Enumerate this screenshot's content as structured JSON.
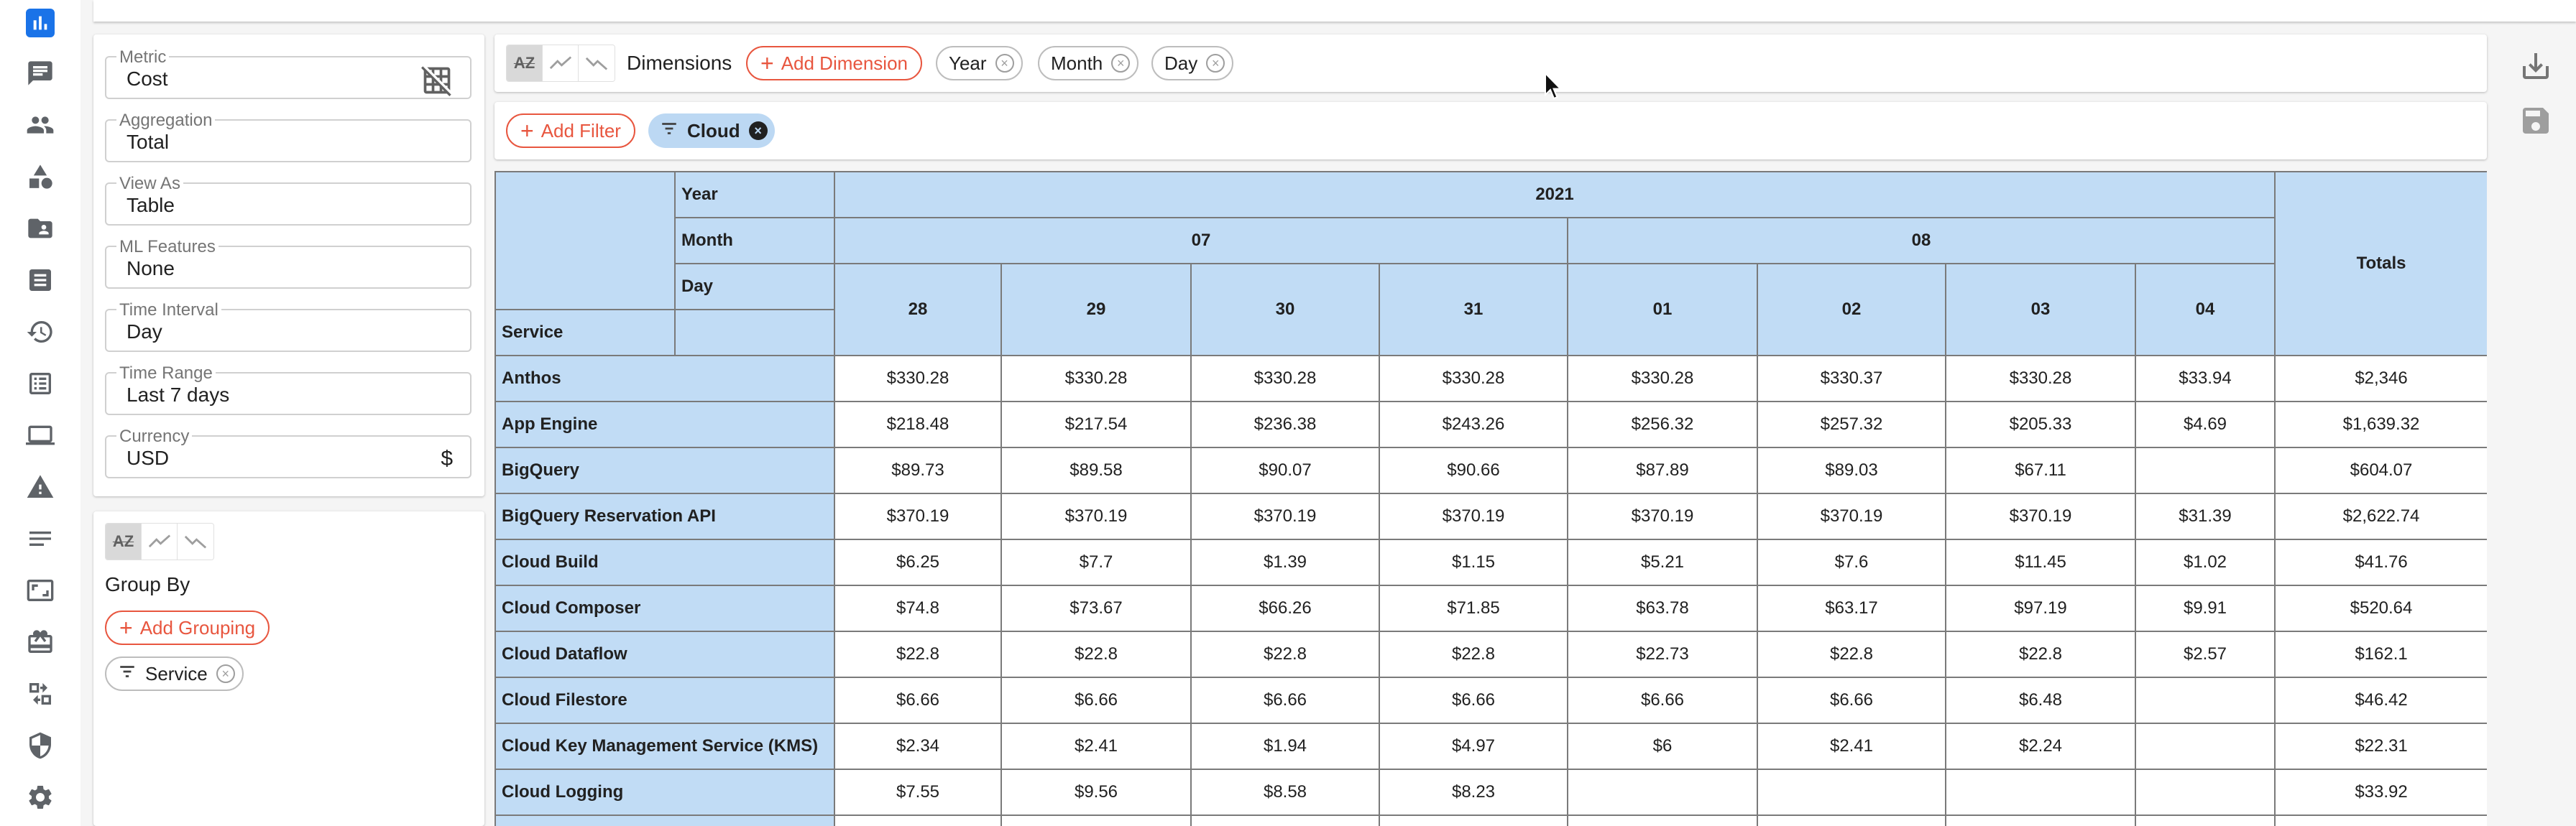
{
  "sidebar": {
    "icons": [
      {
        "name": "reports-icon",
        "active": true
      },
      {
        "name": "chat-icon"
      },
      {
        "name": "users-icon"
      },
      {
        "name": "shapes-icon"
      },
      {
        "name": "folder-shared-icon"
      },
      {
        "name": "invoice-icon"
      },
      {
        "name": "history-icon"
      },
      {
        "name": "list-icon"
      },
      {
        "name": "laptop-icon"
      },
      {
        "name": "warning-icon"
      },
      {
        "name": "notes-icon"
      },
      {
        "name": "screen-icon"
      },
      {
        "name": "gift-icon"
      },
      {
        "name": "sync-icon"
      },
      {
        "name": "shield-icon"
      },
      {
        "name": "gear-icon"
      }
    ]
  },
  "settings": {
    "metric": {
      "label": "Metric",
      "value": "Cost"
    },
    "aggregation": {
      "label": "Aggregation",
      "value": "Total"
    },
    "view_as": {
      "label": "View As",
      "value": "Table"
    },
    "ml_features": {
      "label": "ML Features",
      "value": "None"
    },
    "time_interval": {
      "label": "Time Interval",
      "value": "Day"
    },
    "time_range": {
      "label": "Time Range",
      "value": "Last 7 days"
    },
    "currency": {
      "label": "Currency",
      "value": "USD",
      "symbol": "$"
    }
  },
  "groupby": {
    "title": "Group By",
    "add_label": "Add Grouping",
    "chips": [
      "Service"
    ]
  },
  "dimensions": {
    "title": "Dimensions",
    "add_label": "Add Dimension",
    "chips": [
      "Year",
      "Month",
      "Day"
    ]
  },
  "filters": {
    "add_label": "Add Filter",
    "chips": [
      "Cloud"
    ]
  },
  "table": {
    "row_headers": {
      "year": "Year",
      "month": "Month",
      "day": "Day",
      "service": "Service"
    },
    "year": "2021",
    "months": [
      {
        "label": "07",
        "span": 4
      },
      {
        "label": "08",
        "span": 4
      }
    ],
    "days": [
      "28",
      "29",
      "30",
      "31",
      "01",
      "02",
      "03",
      "04"
    ],
    "totals_label": "Totals",
    "rows": [
      {
        "service": "Anthos",
        "values": [
          "$330.28",
          "$330.28",
          "$330.28",
          "$330.28",
          "$330.28",
          "$330.37",
          "$330.28",
          "$33.94"
        ],
        "total": "$2,346"
      },
      {
        "service": "App Engine",
        "values": [
          "$218.48",
          "$217.54",
          "$236.38",
          "$243.26",
          "$256.32",
          "$257.32",
          "$205.33",
          "$4.69"
        ],
        "total": "$1,639.32"
      },
      {
        "service": "BigQuery",
        "values": [
          "$89.73",
          "$89.58",
          "$90.07",
          "$90.66",
          "$87.89",
          "$89.03",
          "$67.11",
          ""
        ],
        "total": "$604.07"
      },
      {
        "service": "BigQuery Reservation API",
        "values": [
          "$370.19",
          "$370.19",
          "$370.19",
          "$370.19",
          "$370.19",
          "$370.19",
          "$370.19",
          "$31.39"
        ],
        "total": "$2,622.74"
      },
      {
        "service": "Cloud Build",
        "values": [
          "$6.25",
          "$7.7",
          "$1.39",
          "$1.15",
          "$5.21",
          "$7.6",
          "$11.45",
          "$1.02"
        ],
        "total": "$41.76"
      },
      {
        "service": "Cloud Composer",
        "values": [
          "$74.8",
          "$73.67",
          "$66.26",
          "$71.85",
          "$63.78",
          "$63.17",
          "$97.19",
          "$9.91"
        ],
        "total": "$520.64"
      },
      {
        "service": "Cloud Dataflow",
        "values": [
          "$22.8",
          "$22.8",
          "$22.8",
          "$22.8",
          "$22.73",
          "$22.8",
          "$22.8",
          "$2.57"
        ],
        "total": "$162.1"
      },
      {
        "service": "Cloud Filestore",
        "values": [
          "$6.66",
          "$6.66",
          "$6.66",
          "$6.66",
          "$6.66",
          "$6.66",
          "$6.48",
          ""
        ],
        "total": "$46.42"
      },
      {
        "service": "Cloud Key Management Service (KMS)",
        "values": [
          "$2.34",
          "$2.41",
          "$1.94",
          "$4.97",
          "$6",
          "$2.41",
          "$2.24",
          ""
        ],
        "total": "$22.31"
      },
      {
        "service": "Cloud Logging",
        "values": [
          "$7.55",
          "$9.56",
          "$8.58",
          "$8.23",
          "",
          "",
          "",
          ""
        ],
        "total": "$33.92"
      },
      {
        "service": "",
        "values": [
          "",
          "",
          "",
          "",
          "",
          "",
          "",
          ""
        ],
        "total": ""
      }
    ]
  }
}
